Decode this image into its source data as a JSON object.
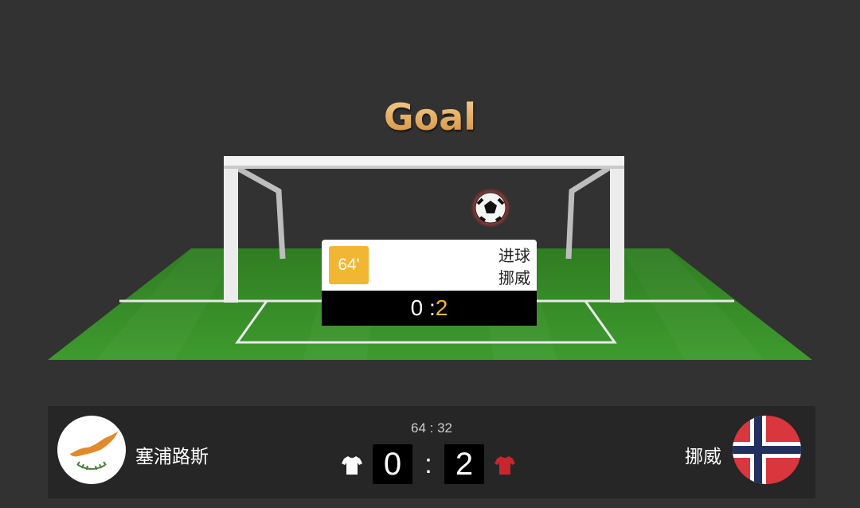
{
  "header": {
    "title": "Goal"
  },
  "event": {
    "minute": "64'",
    "type": "进球",
    "team": "挪威",
    "score_home": "0 :",
    "score_away": "2"
  },
  "match": {
    "clock": "64 : 32",
    "home": {
      "name": "塞浦路斯",
      "score": "0",
      "shirt_color": "#ffffff",
      "logo": "cyprus-flag"
    },
    "separator": ":",
    "away": {
      "name": "挪威",
      "score": "2",
      "shirt_color": "#c8262c",
      "logo": "norway-flag"
    }
  },
  "colors": {
    "accent": "#f1b632",
    "pitch": "#3a8a2a",
    "background": "#323232"
  }
}
